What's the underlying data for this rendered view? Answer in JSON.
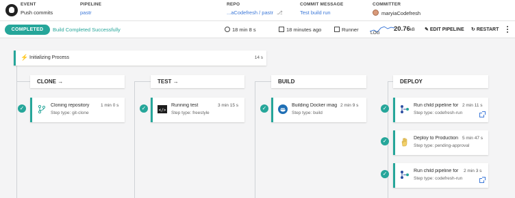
{
  "header": {
    "event_label": "EVENT",
    "event_value": "Push commits",
    "pipeline_label": "PIPELINE",
    "pipeline_value": "pastr",
    "repo_label": "REPO",
    "repo_value": "...aCodefresh / pastr",
    "commit_label": "COMMIT MESSAGE",
    "commit_value": "Test build run",
    "committer_label": "COMMITTER",
    "committer_value": "maryiaCodefresh"
  },
  "status": {
    "badge": "COMPLETED",
    "message": "Build Completed Successfully",
    "duration": "18 min 8 s",
    "started": "18 minutes ago",
    "runner": "Runner",
    "log_label": "LOG",
    "log_size": "20.76",
    "log_unit": "kB",
    "edit_label": "EDIT PIPELINE",
    "restart_label": "RESTART",
    "accent": "#26a69a"
  },
  "init": {
    "label": "Initializing Process",
    "time": "14 s"
  },
  "stages": [
    {
      "name": "CLONE →"
    },
    {
      "name": "TEST →"
    },
    {
      "name": "BUILD"
    },
    {
      "name": "DEPLOY"
    }
  ],
  "steps": {
    "clone": {
      "title": "Cloning repository",
      "time": "1 min 0 s",
      "type": "Step type: git-clone",
      "icon": "git-branch-icon"
    },
    "test": {
      "title": "Running test",
      "time": "3 min 15 s",
      "type": "Step type: freestyle",
      "icon": "terminal-icon"
    },
    "build": {
      "title": "Building Docker image",
      "time": "2 min 9 s",
      "type": "Step type: build",
      "icon": "docker-icon"
    },
    "deploy1": {
      "title": "Run child pipeline for",
      "time": "2 min 11 s",
      "type": "Step type: codefresh-run",
      "icon": "pipeline-icon"
    },
    "deploy2": {
      "title": "Deploy to Production",
      "time": "5 min 47 s",
      "type": "Step type: pending-approval",
      "icon": "hand-icon"
    },
    "deploy3": {
      "title": "Run child pipeline for",
      "time": "2 min 3 s",
      "type": "Step type: codefresh-run",
      "icon": "pipeline-icon"
    }
  }
}
